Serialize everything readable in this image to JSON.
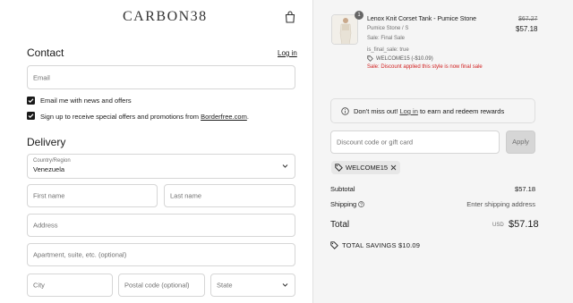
{
  "brand": {
    "logo": "CARBON38"
  },
  "contact": {
    "heading": "Contact",
    "login_link": "Log in",
    "email_placeholder": "Email",
    "news_checkbox": "Email me with news and offers",
    "promo_checkbox_prefix": "Sign up to receive special offers and promotions from ",
    "promo_checkbox_link": "Borderfree.com",
    "promo_checkbox_suffix": "."
  },
  "delivery": {
    "heading": "Delivery",
    "country_label": "Country/Region",
    "country_value": "Venezuela",
    "first_name": "First name",
    "last_name": "Last name",
    "address": "Address",
    "apartment": "Apartment, suite, etc. (optional)",
    "city": "City",
    "postal": "Postal code (optional)",
    "state": "State"
  },
  "summary": {
    "product": {
      "quantity": "1",
      "title": "Lenox Knit Corset Tank - Pumice Stone",
      "variant": "Pumice Stone / S",
      "sale_note": "Sale: Final Sale",
      "meta": "is_final_sale: true",
      "discount_tag": "WELCOME15 (-$10.09)",
      "discount_warning": "Sale: Discount applied this style is now final sale",
      "price_original": "$67.27",
      "price_current": "$57.18"
    },
    "notice": {
      "prefix": "Don't miss out! ",
      "link": "Log in",
      "suffix": " to earn and redeem rewards"
    },
    "discount_placeholder": "Discount code or gift card",
    "apply_label": "Apply",
    "applied_code": "WELCOME15",
    "subtotal_label": "Subtotal",
    "subtotal_value": "$57.18",
    "shipping_label": "Shipping",
    "shipping_value": "Enter shipping address",
    "total_label": "Total",
    "currency": "USD",
    "total_value": "$57.18",
    "savings": "TOTAL SAVINGS $10.09"
  },
  "icons": {
    "bag": "shopping-bag-icon",
    "check": "checkmark-icon",
    "chevron": "chevron-down-icon",
    "info": "info-icon",
    "tag": "tag-icon",
    "close": "close-icon",
    "help": "question-icon"
  }
}
